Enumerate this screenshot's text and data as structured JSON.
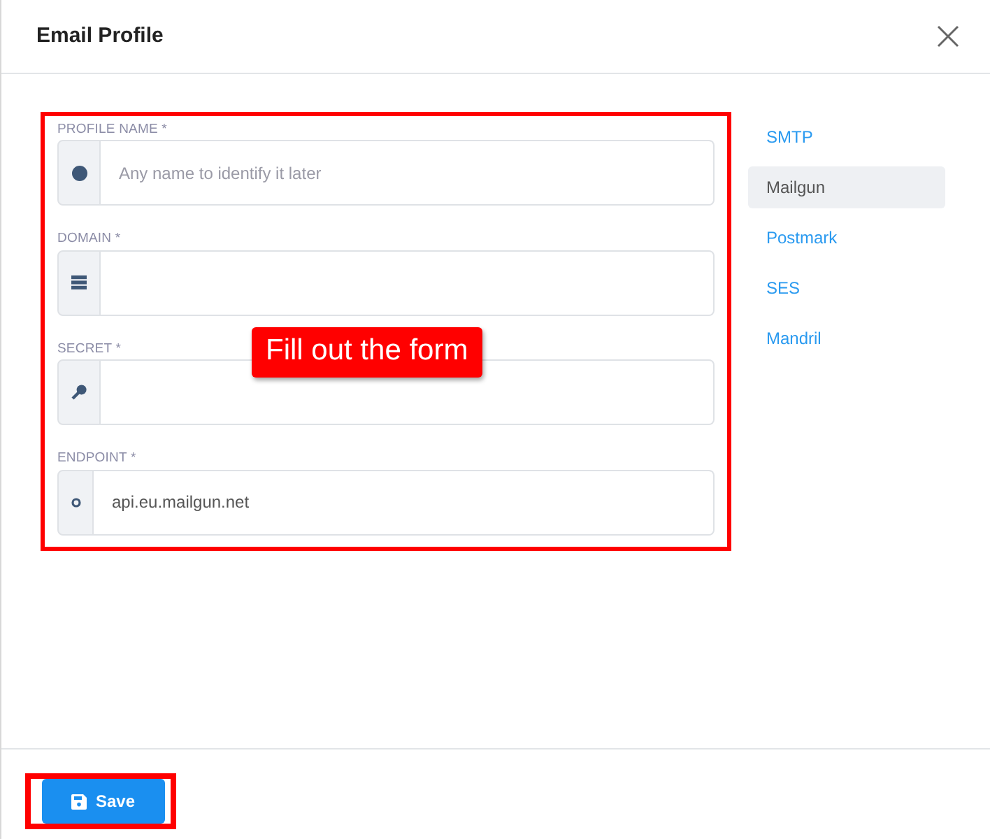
{
  "dialog": {
    "title": "Email Profile"
  },
  "fields": [
    {
      "label": "PROFILE NAME *",
      "placeholder": "Any name to identify it later"
    },
    {
      "label": "DOMAIN *"
    },
    {
      "label": "SECRET *"
    },
    {
      "label": "ENDPOINT *",
      "value": "api.eu.mailgun.net"
    }
  ],
  "providers": [
    {
      "label": "SMTP",
      "selected": false
    },
    {
      "label": "Mailgun",
      "selected": true
    },
    {
      "label": "Postmark",
      "selected": false
    },
    {
      "label": "SES",
      "selected": false
    },
    {
      "label": "Mandril",
      "selected": false
    }
  ],
  "callout": "Fill out the form",
  "footer": {
    "save_button": "Save"
  }
}
